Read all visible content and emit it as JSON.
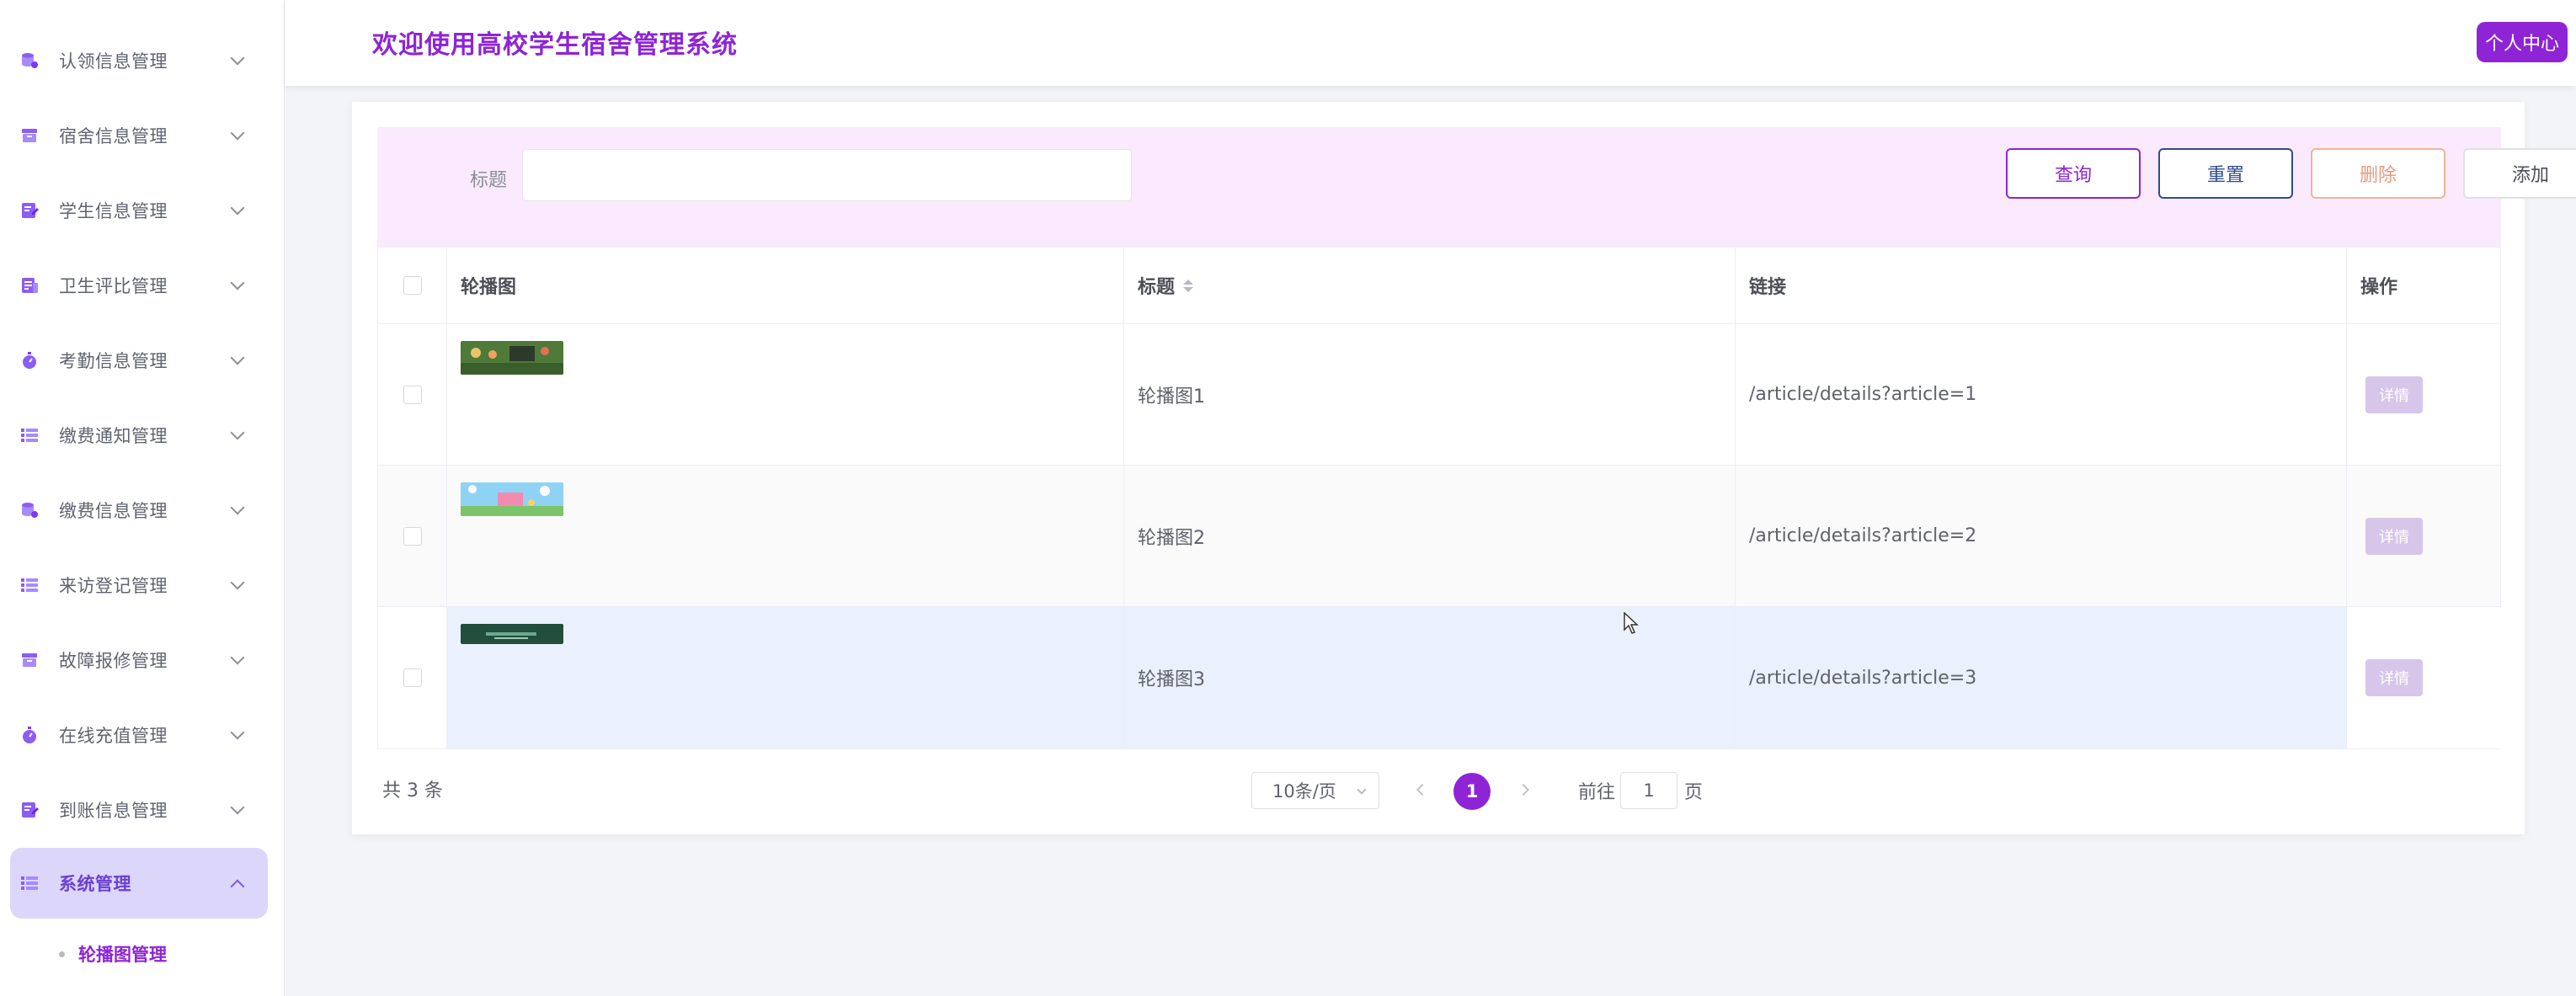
{
  "header": {
    "title": "欢迎使用高校学生宿舍管理系统",
    "user_center": "个人中心"
  },
  "sidebar": {
    "items": [
      {
        "label": "认领信息管理",
        "icon": "database-icon"
      },
      {
        "label": "宿舍信息管理",
        "icon": "archive-icon"
      },
      {
        "label": "学生信息管理",
        "icon": "form-icon"
      },
      {
        "label": "卫生评比管理",
        "icon": "document-icon"
      },
      {
        "label": "考勤信息管理",
        "icon": "stopwatch-icon"
      },
      {
        "label": "缴费通知管理",
        "icon": "list-icon"
      },
      {
        "label": "缴费信息管理",
        "icon": "database-icon"
      },
      {
        "label": "来访登记管理",
        "icon": "list-icon"
      },
      {
        "label": "故障报修管理",
        "icon": "archive-icon"
      },
      {
        "label": "在线充值管理",
        "icon": "stopwatch-icon"
      },
      {
        "label": "到账信息管理",
        "icon": "form-icon"
      },
      {
        "label": "系统管理",
        "icon": "list-icon"
      }
    ],
    "sub_item": "轮播图管理"
  },
  "filter": {
    "title_label": "标题",
    "title_value": "",
    "query_button": "查询",
    "reset_button": "重置",
    "delete_button": "删除",
    "add_button": "添加"
  },
  "table": {
    "columns": [
      "轮播图",
      "标题",
      "链接",
      "操作"
    ],
    "rows": [
      {
        "title": "轮播图1",
        "link": "/article/details?article=1",
        "action": "详情"
      },
      {
        "title": "轮播图2",
        "link": "/article/details?article=2",
        "action": "详情"
      },
      {
        "title": "轮播图3",
        "link": "/article/details?article=3",
        "action": "详情"
      }
    ]
  },
  "pagination": {
    "total": "共 3 条",
    "page_size": "10条/页",
    "current_page": "1",
    "goto_label": "前往",
    "jump_value": "1",
    "page_suffix": "页"
  },
  "colors": {
    "accent": "#8e24d6",
    "sidebar_active_bg": "#dcd6fb",
    "filter_bg": "#fbeafd",
    "reset_border": "#2f4d8c",
    "delete_border": "#f0b49b",
    "detail_button": "#d7c6ea",
    "hover_row": "#eaf1fc"
  }
}
